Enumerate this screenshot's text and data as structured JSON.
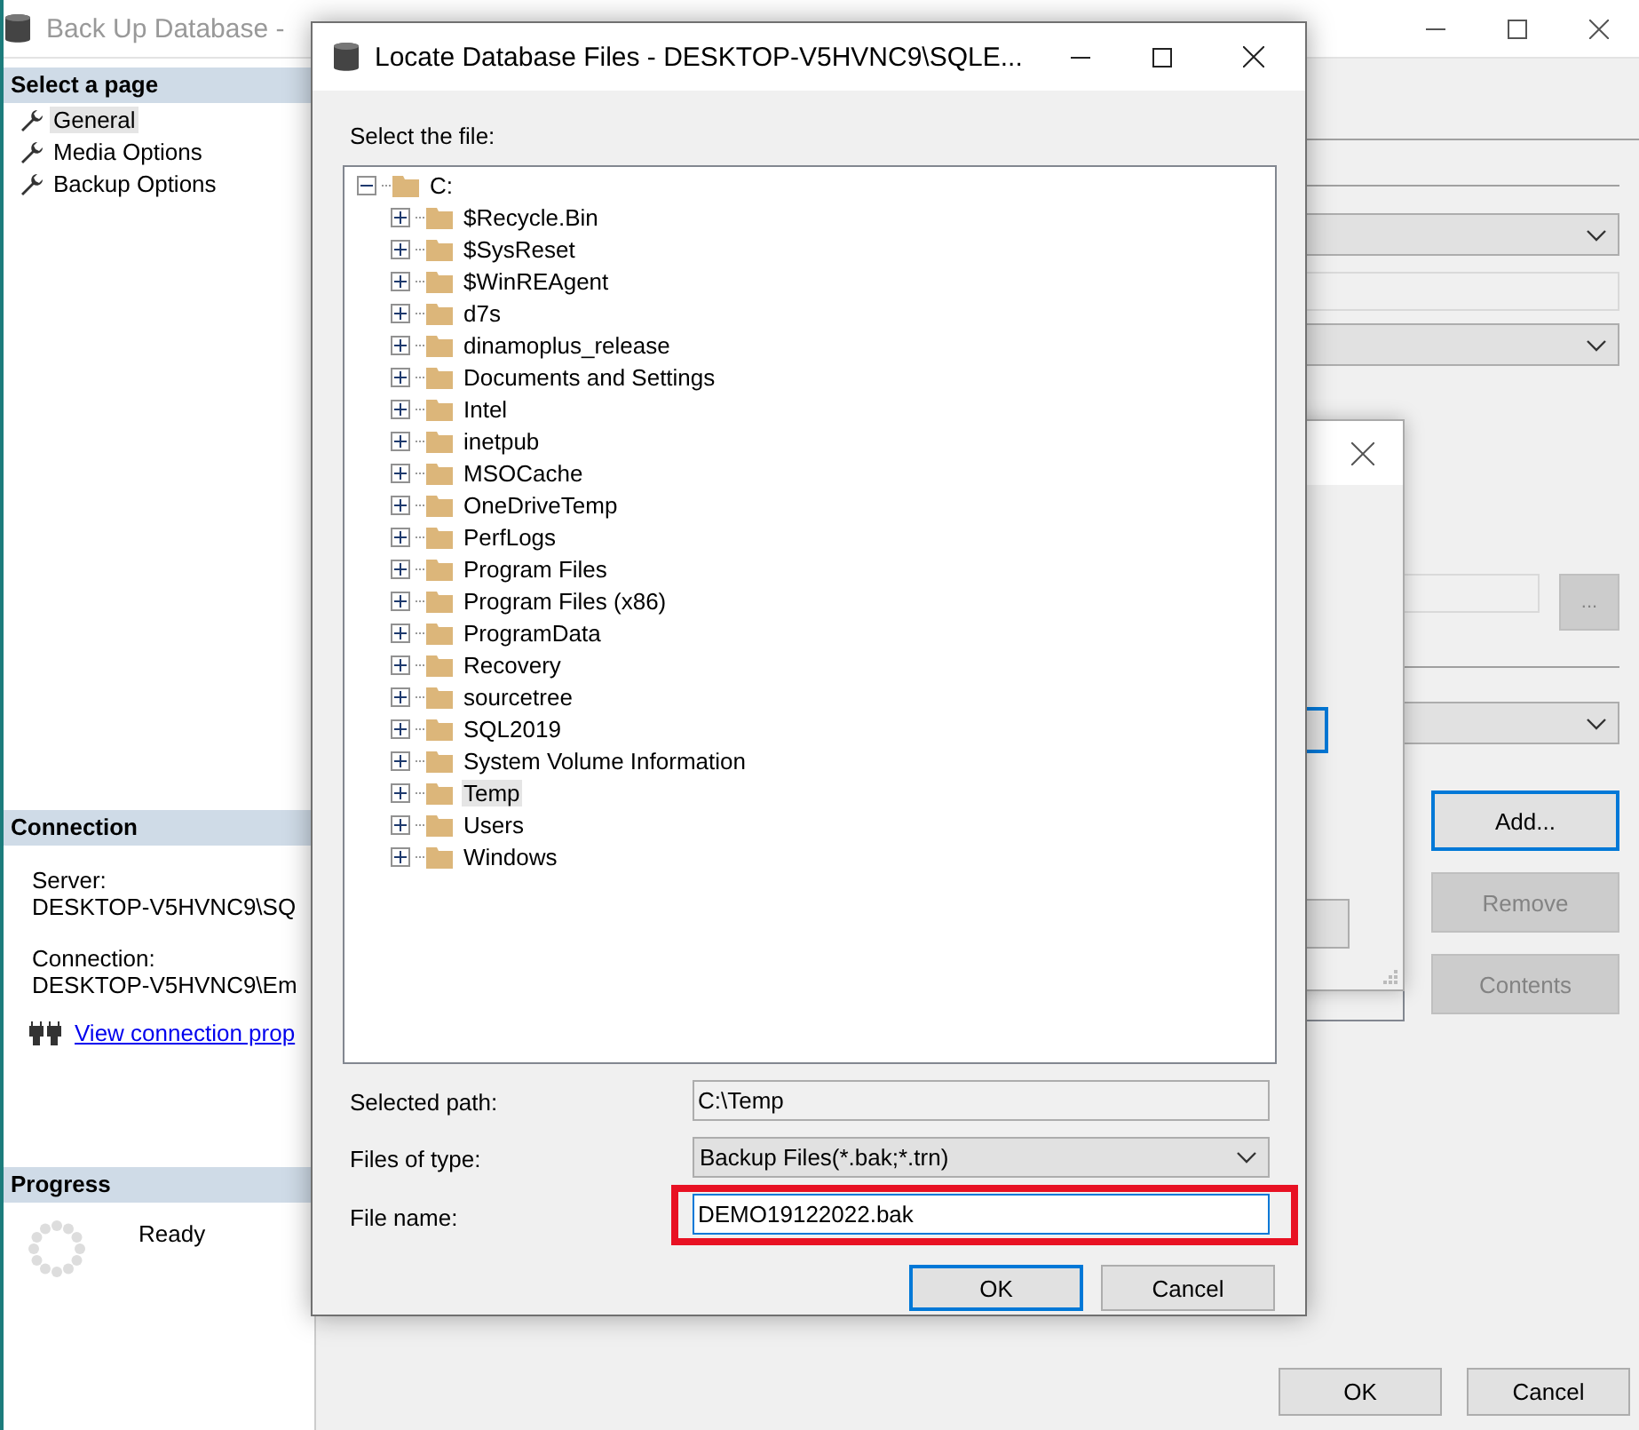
{
  "background_window": {
    "title": "Back Up Database -",
    "sidebar": {
      "select_page_header": "Select a page",
      "pages": [
        {
          "label": "General",
          "selected": true
        },
        {
          "label": "Media Options",
          "selected": false
        },
        {
          "label": "Backup Options",
          "selected": false
        }
      ],
      "connection_header": "Connection",
      "server_label": "Server:",
      "server_value": "DESKTOP-V5HVNC9\\SQ",
      "connection_label": "Connection:",
      "connection_value": "DESKTOP-V5HVNC9\\Em",
      "connection_link": "View connection prop",
      "progress_header": "Progress",
      "progress_status": "Ready"
    },
    "browse_button": "...",
    "side_buttons": [
      {
        "label": "Add...",
        "disabled": false,
        "focused": true
      },
      {
        "label": "Remove",
        "disabled": true,
        "focused": false
      },
      {
        "label": "Contents",
        "disabled": true,
        "focused": false
      }
    ],
    "footer_buttons": [
      "OK",
      "Cancel"
    ]
  },
  "locate_dialog": {
    "title": "Locate Database Files - DESKTOP-V5HVNC9\\SQLE...",
    "select_label": "Select the file:",
    "tree": [
      {
        "label": "C:",
        "expanded": true,
        "selected": false,
        "children": [
          {
            "label": "$Recycle.Bin",
            "expanded": false,
            "selected": false
          },
          {
            "label": "$SysReset",
            "expanded": false,
            "selected": false
          },
          {
            "label": "$WinREAgent",
            "expanded": false,
            "selected": false
          },
          {
            "label": "d7s",
            "expanded": false,
            "selected": false
          },
          {
            "label": "dinamoplus_release",
            "expanded": false,
            "selected": false
          },
          {
            "label": "Documents and Settings",
            "expanded": false,
            "selected": false
          },
          {
            "label": "Intel",
            "expanded": false,
            "selected": false
          },
          {
            "label": "inetpub",
            "expanded": false,
            "selected": false
          },
          {
            "label": "MSOCache",
            "expanded": false,
            "selected": false
          },
          {
            "label": "OneDriveTemp",
            "expanded": false,
            "selected": false
          },
          {
            "label": "PerfLogs",
            "expanded": false,
            "selected": false
          },
          {
            "label": "Program Files",
            "expanded": false,
            "selected": false
          },
          {
            "label": "Program Files (x86)",
            "expanded": false,
            "selected": false
          },
          {
            "label": "ProgramData",
            "expanded": false,
            "selected": false
          },
          {
            "label": "Recovery",
            "expanded": false,
            "selected": false
          },
          {
            "label": "sourcetree",
            "expanded": false,
            "selected": false
          },
          {
            "label": "SQL2019",
            "expanded": false,
            "selected": false
          },
          {
            "label": "System Volume Information",
            "expanded": false,
            "selected": false
          },
          {
            "label": "Temp",
            "expanded": false,
            "selected": true
          },
          {
            "label": "Users",
            "expanded": false,
            "selected": false
          },
          {
            "label": "Windows",
            "expanded": false,
            "selected": false
          }
        ]
      }
    ],
    "selected_path_label": "Selected path:",
    "selected_path": "C:\\Temp",
    "files_of_type_label": "Files of type:",
    "files_of_type": "Backup Files(*.bak;*.trn)",
    "file_name_label": "File name:",
    "file_name": "DEMO19122022.bak",
    "file_name_highlighted": true,
    "buttons": [
      {
        "label": "OK",
        "default": true
      },
      {
        "label": "Cancel",
        "default": false
      }
    ]
  }
}
